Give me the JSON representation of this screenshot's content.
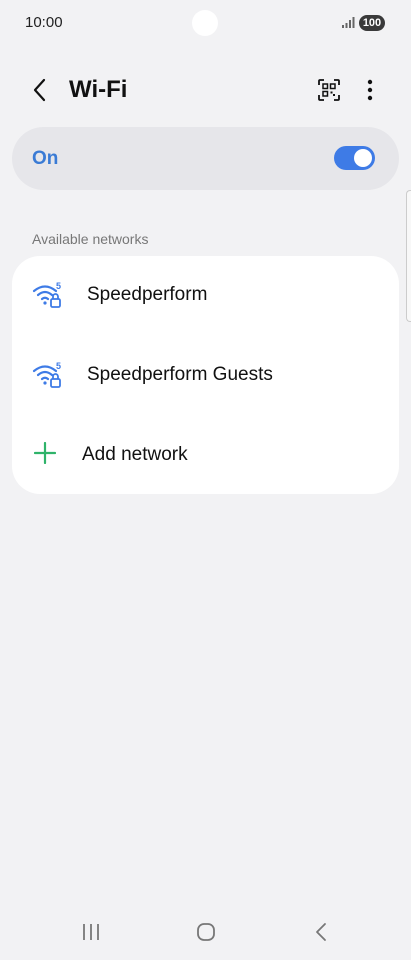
{
  "status_bar": {
    "time": "10:00",
    "battery": "100"
  },
  "header": {
    "title": "Wi-Fi",
    "icons": {
      "back": "back-chevron-icon",
      "qr": "qr-scan-icon",
      "more": "more-vertical-icon"
    }
  },
  "wifi_toggle": {
    "label": "On",
    "enabled": true,
    "color": "#3e7be6"
  },
  "networks": {
    "section_label": "Available networks",
    "items": [
      {
        "name": "Speedperform",
        "band": "5",
        "secured": true
      },
      {
        "name": "Speedperform Guests",
        "band": "5",
        "secured": true
      }
    ],
    "add_label": "Add network",
    "add_color": "#2fb36a"
  },
  "nav_bar": {
    "recents": "recents-icon",
    "home": "home-icon",
    "back": "back-icon"
  }
}
